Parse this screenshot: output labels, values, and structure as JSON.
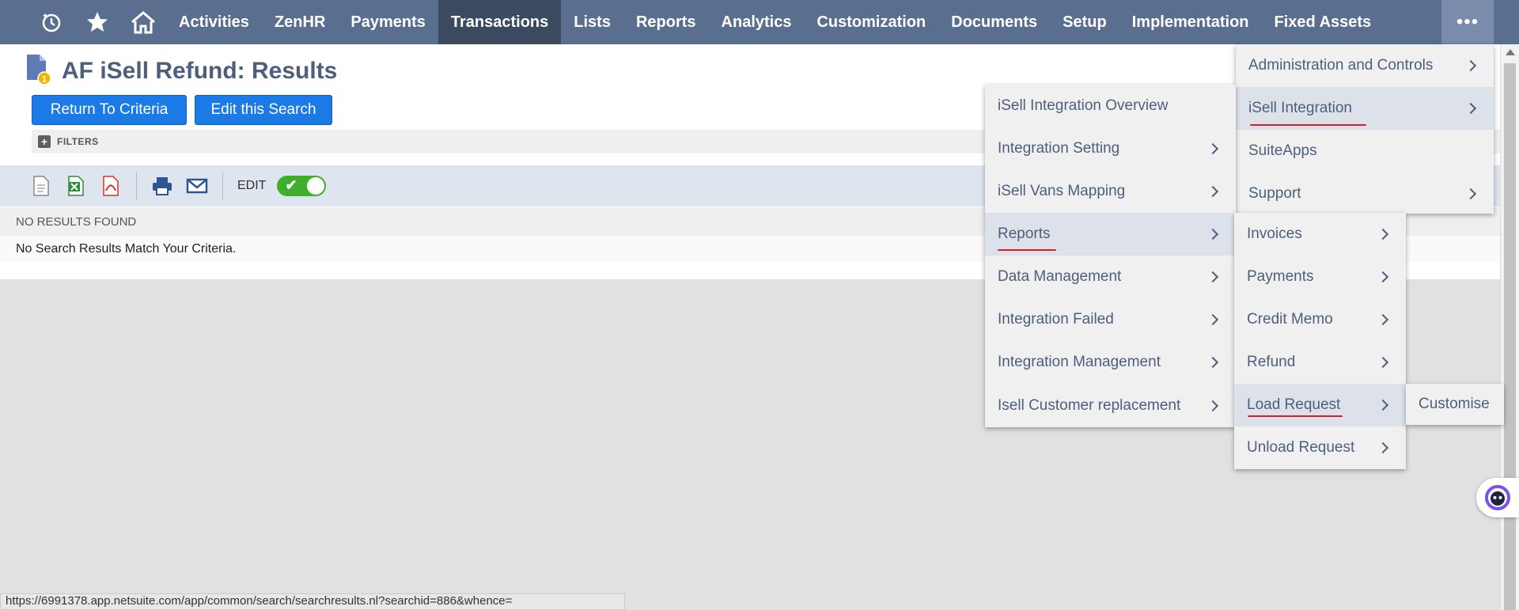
{
  "nav": {
    "items": [
      "Activities",
      "ZenHR",
      "Payments",
      "Transactions",
      "Lists",
      "Reports",
      "Analytics",
      "Customization",
      "Documents",
      "Setup",
      "Implementation",
      "Fixed Assets"
    ],
    "more": "•••"
  },
  "page": {
    "title": "AF iSell Refund: Results",
    "return_button": "Return To Criteria",
    "edit_button": "Edit this Search",
    "filters_label": "FILTERS",
    "edit_label": "EDIT",
    "no_results_header": "NO RESULTS FOUND",
    "no_results_message": "No Search Results Match Your Criteria."
  },
  "menu_more": {
    "items": [
      "Administration and Controls",
      "iSell Integration",
      "SuiteApps",
      "Support"
    ]
  },
  "menu_isell": {
    "items": [
      "iSell Integration Overview",
      "Integration Setting",
      "iSell Vans Mapping",
      "Reports",
      "Data Management",
      "Integration Failed",
      "Integration Management",
      "Isell Customer replacement"
    ]
  },
  "menu_reports": {
    "items": [
      "Invoices",
      "Payments",
      "Credit Memo",
      "Refund",
      "Load Request",
      "Unload Request"
    ]
  },
  "menu_load": {
    "items": [
      "Customise"
    ]
  },
  "status_url": "https://6991378.app.netsuite.com/app/common/search/searchresults.nl?searchid=886&whence="
}
